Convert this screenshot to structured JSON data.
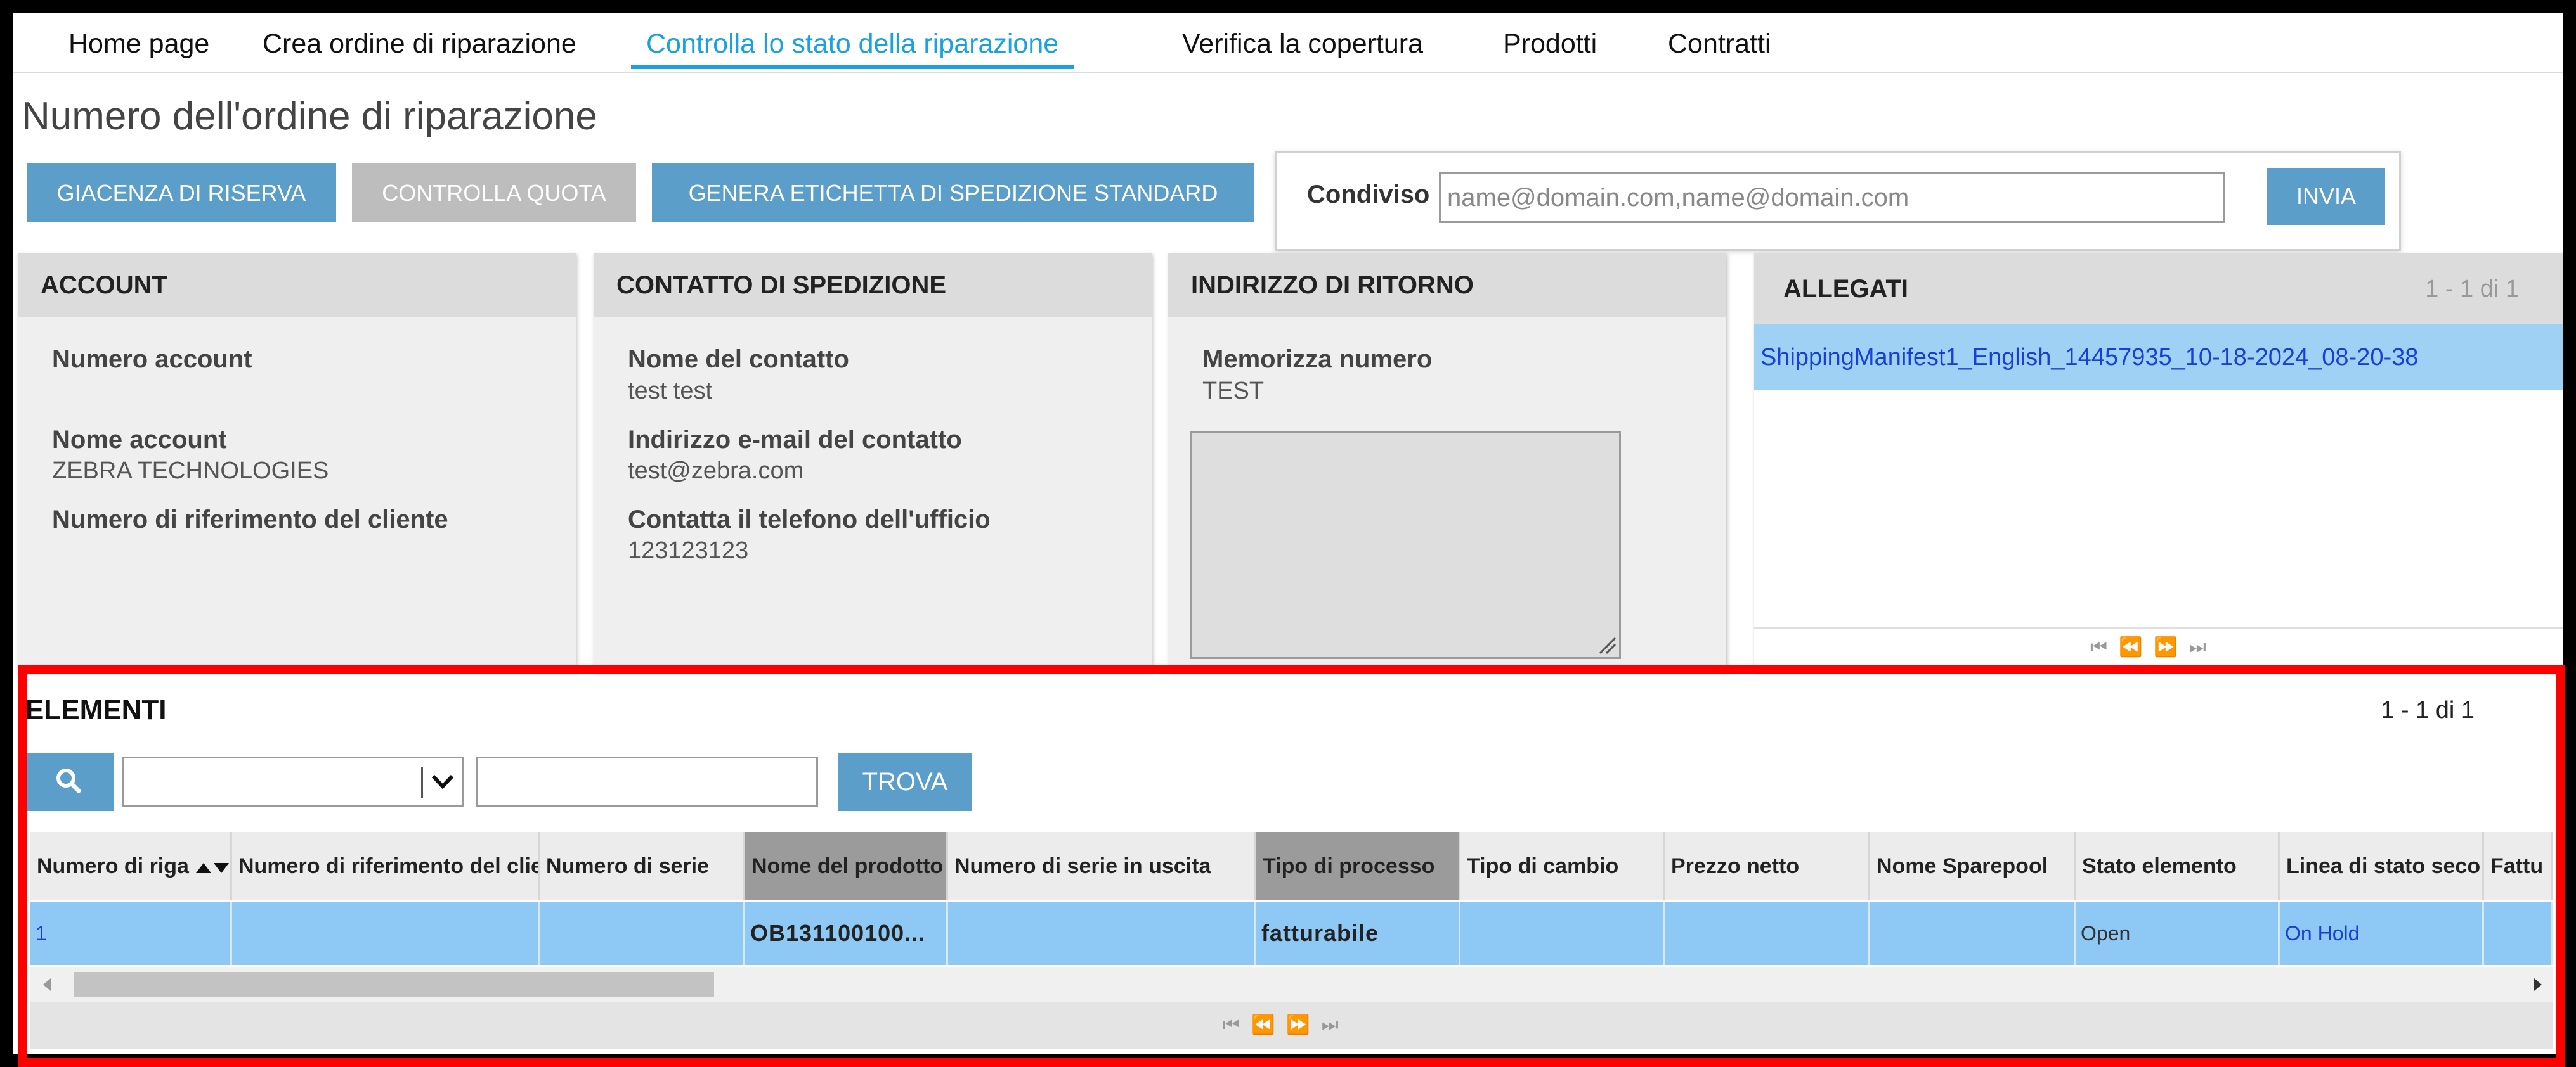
{
  "nav": {
    "tabs": [
      {
        "label": "Home page"
      },
      {
        "label": "Crea ordine di riparazione"
      },
      {
        "label": "Controlla lo stato della riparazione"
      },
      {
        "label": "Verifica la copertura"
      },
      {
        "label": "Prodotti"
      },
      {
        "label": "Contratti"
      }
    ]
  },
  "page_title": "Numero dell'ordine di riparazione",
  "actions": {
    "reserve_stock": "GIACENZA DI RISERVA",
    "check_quota": "CONTROLLA QUOTA",
    "generate_label": "GENERA ETICHETTA DI SPEDIZIONE STANDARD"
  },
  "share": {
    "label": "Condiviso",
    "placeholder": "name@domain.com,name@domain.com",
    "send": "INVIA"
  },
  "account": {
    "header": "ACCOUNT",
    "account_number_label": "Numero account",
    "account_name_label": "Nome account",
    "account_name_value": "ZEBRA TECHNOLOGIES",
    "customer_ref_label": "Numero di riferimento del cliente"
  },
  "shipping_contact": {
    "header": "CONTATTO DI SPEDIZIONE",
    "contact_name_label": "Nome del contatto",
    "contact_name_value": "test test",
    "email_label": "Indirizzo e-mail del contatto",
    "email_value": "test@zebra.com",
    "phone_label": "Contatta il telefono dell'ufficio",
    "phone_value": "123123123"
  },
  "return_address": {
    "header": "INDIRIZZO DI RITORNO",
    "store_number_label": "Memorizza numero",
    "store_number_value": "TEST"
  },
  "attachments": {
    "header": "ALLEGATI",
    "count": "1 - 1 di 1",
    "files": [
      "ShippingManifest1_English_14457935_10-18-2024_08-20-38"
    ]
  },
  "elements": {
    "title": "ELEMENTI",
    "count": "1 - 1 di 1",
    "find_button": "TROVA",
    "columns": [
      "Numero di riga",
      "Numero di riferimento del clie",
      "Numero di serie",
      "Nome del prodotto",
      "Numero di serie in uscita",
      "Tipo di processo",
      "Tipo di cambio",
      "Prezzo netto",
      "Nome Sparepool",
      "Stato elemento",
      "Linea di stato seco",
      "Fattu"
    ],
    "rows": [
      [
        "1",
        "",
        "",
        "OB131100100...",
        "",
        "fatturabile",
        "",
        "",
        "",
        "Open",
        "On Hold",
        ""
      ]
    ]
  },
  "colors": {
    "accent": "#1aa1e0",
    "button_blue": "#5b9ec9",
    "button_disabled": "#bdbdbd",
    "selected_row": "#8ec8f5",
    "highlight_box": "#ff0000"
  }
}
